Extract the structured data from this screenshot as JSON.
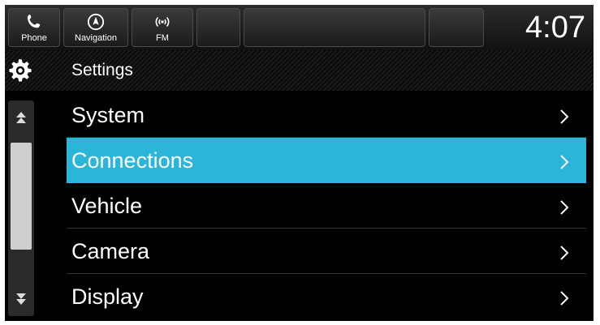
{
  "topbar": {
    "shortcuts": [
      {
        "label": "Phone",
        "icon": "phone-icon"
      },
      {
        "label": "Navigation",
        "icon": "navigation-icon"
      },
      {
        "label": "FM",
        "icon": "radio-fm-icon"
      }
    ],
    "clock": "4:07"
  },
  "header": {
    "title": "Settings",
    "icon": "gear-icon"
  },
  "menu": {
    "items": [
      {
        "label": "System"
      },
      {
        "label": "Connections",
        "selected": true
      },
      {
        "label": "Vehicle"
      },
      {
        "label": "Camera"
      },
      {
        "label": "Display"
      }
    ]
  },
  "colors": {
    "selected": "#2bb6d9",
    "background": "#000000",
    "text": "#ffffff"
  }
}
